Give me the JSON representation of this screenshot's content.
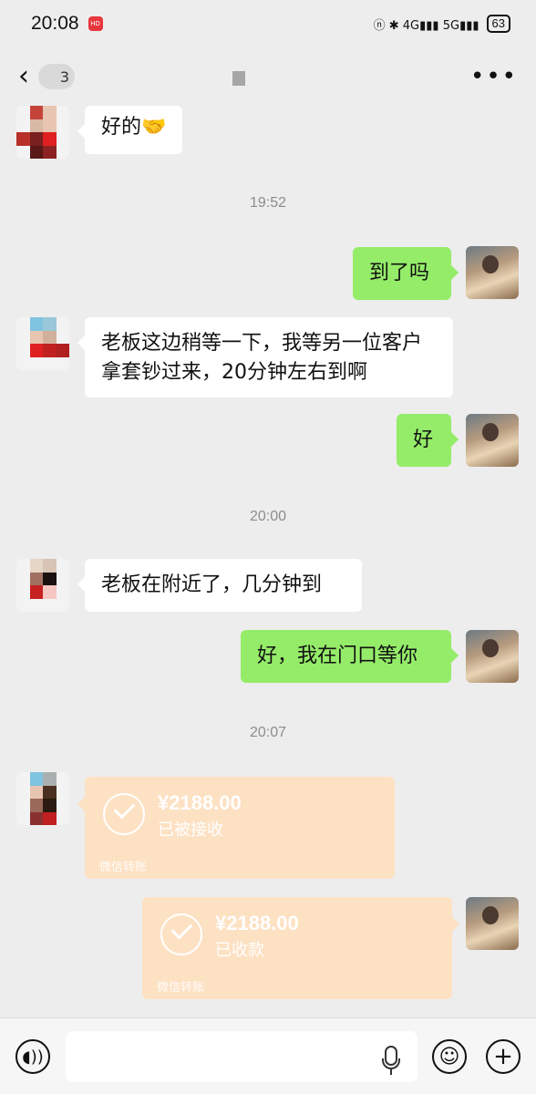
{
  "status_bar": {
    "time": "20:08",
    "app_badge": "HD",
    "network_icons": "ⓝ ✱ 4G▮▮▮ 5G▮▮▮",
    "battery": "63"
  },
  "nav": {
    "contact_name_visible": "3",
    "more": "•••"
  },
  "messages": [
    {
      "side": "in",
      "text": "好的🤝"
    },
    {
      "time": "19:52"
    },
    {
      "side": "out",
      "text": "到了吗"
    },
    {
      "side": "in",
      "text": "老板这边稍等一下，我等另一位客户拿套钞过来，20分钟左右到啊"
    },
    {
      "side": "out",
      "text": "好"
    },
    {
      "time": "20:00"
    },
    {
      "side": "in",
      "text": "老板在附近了，几分钟到"
    },
    {
      "side": "out",
      "text": "好，我在门口等你"
    },
    {
      "time": "20:07"
    }
  ],
  "transfers": [
    {
      "side": "in",
      "amount": "¥2188.00",
      "status": "已被接收",
      "label": "微信转账"
    },
    {
      "side": "out",
      "amount": "¥2188.00",
      "status": "已收款",
      "label": "微信转账"
    }
  ],
  "input": {
    "placeholder": ""
  },
  "colors": {
    "background": "#ededed",
    "incoming_bubble": "#ffffff",
    "outgoing_bubble": "#95ec69",
    "transfer_card": "#fde1c3"
  },
  "icons": [
    "back-arrow-icon",
    "more-icon",
    "voice-icon",
    "mic-icon",
    "emoji-icon",
    "plus-icon",
    "check-icon"
  ]
}
